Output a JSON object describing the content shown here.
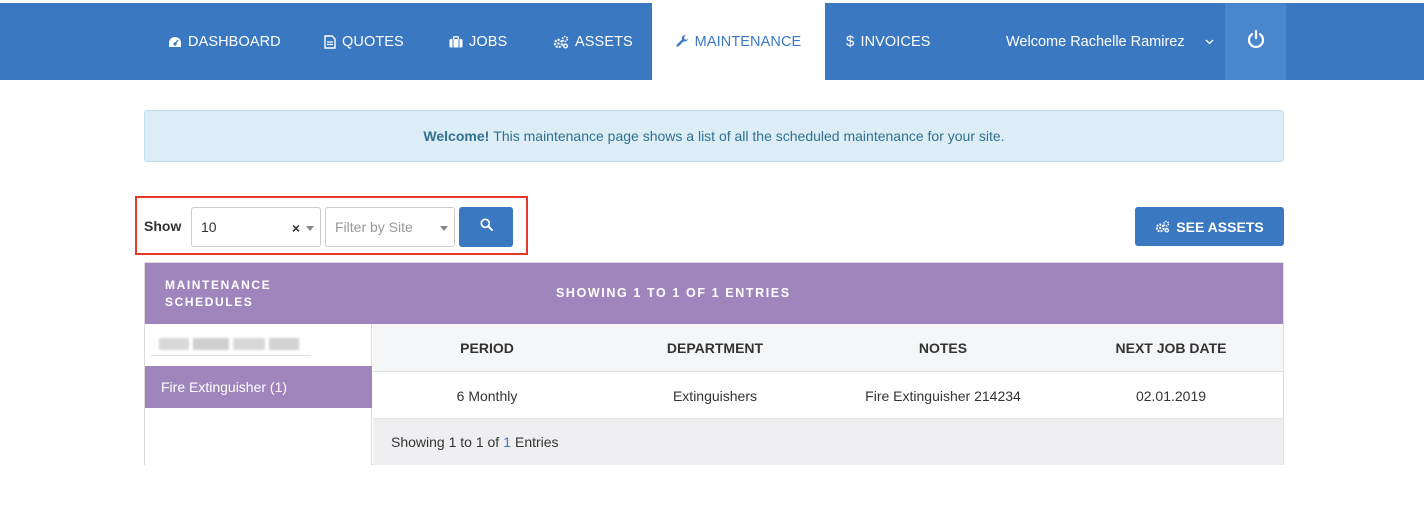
{
  "nav": {
    "items": [
      {
        "label": "DASHBOARD",
        "icon": "dashboard-icon"
      },
      {
        "label": "QUOTES",
        "icon": "document-icon"
      },
      {
        "label": "JOBS",
        "icon": "briefcase-icon"
      },
      {
        "label": "ASSETS",
        "icon": "gears-icon"
      },
      {
        "label": "MAINTENANCE",
        "icon": "wrench-icon",
        "active": true
      },
      {
        "label": "INVOICES",
        "icon": "dollar-icon"
      }
    ],
    "welcome": "Welcome Rachelle Ramirez",
    "accent": "#3b78c2"
  },
  "alert": {
    "strong": "Welcome!",
    "text": "This maintenance page shows a list of all the scheduled maintenance for your site."
  },
  "filters": {
    "show_label": "Show",
    "show_value": "10",
    "clear": "×",
    "site_placeholder": "Filter by Site"
  },
  "see_assets_label": "SEE ASSETS",
  "panel": {
    "left_title": "MAINTENANCE SCHEDULES",
    "summary": "SHOWING 1 TO 1 OF 1 ENTRIES",
    "sidebar_items": [
      "Fire Extinguisher (1)"
    ],
    "columns": [
      "PERIOD",
      "DEPARTMENT",
      "NOTES",
      "NEXT JOB DATE"
    ],
    "rows": [
      [
        "6 Monthly",
        "Extinguishers",
        "Fire Extinguisher 214234",
        "02.01.2019"
      ]
    ],
    "footer": {
      "prefix": "Showing 1 to 1 of",
      "link": "1",
      "suffix": "Entries"
    },
    "header_color": "#a085bd"
  }
}
